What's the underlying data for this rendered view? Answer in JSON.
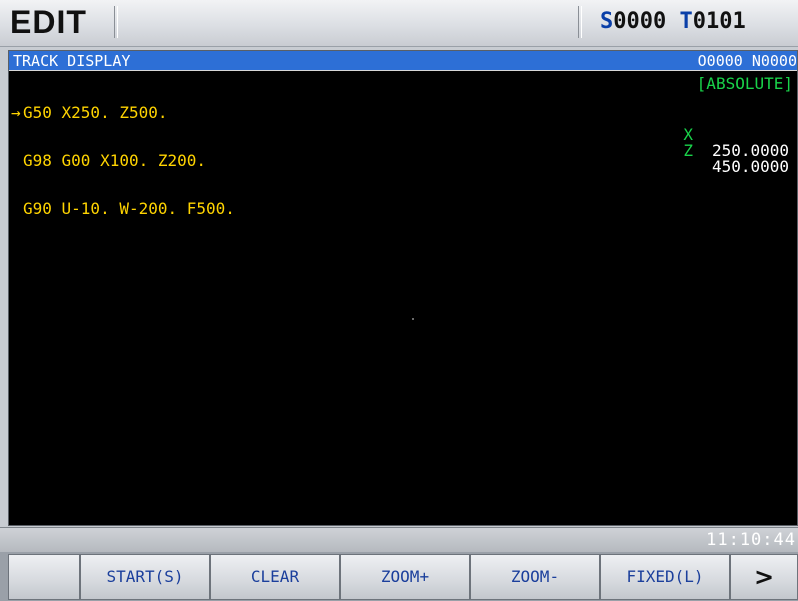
{
  "header": {
    "mode": "EDIT",
    "spindle_prefix": "S",
    "spindle_value": "0000",
    "tool_prefix": "T",
    "tool_value": "0101"
  },
  "screen": {
    "title": "TRACK DISPLAY",
    "program_number": "O0000 N0000",
    "code_lines": [
      "G50 X250. Z500.",
      "G98 G00 X100. Z200.",
      "G90 U-10. W-200. F500."
    ],
    "current_line_marker": "→",
    "coord_mode": "[ABSOLUTE]",
    "coords": [
      {
        "axis": "X",
        "value": "250.0000"
      },
      {
        "axis": "Z",
        "value": "450.0000"
      }
    ]
  },
  "status": {
    "time": "11:10:44"
  },
  "softkeys": [
    {
      "label": ""
    },
    {
      "label": "START(S)"
    },
    {
      "label": "CLEAR"
    },
    {
      "label": "ZOOM+"
    },
    {
      "label": "ZOOM-"
    },
    {
      "label": "FIXED(L)"
    },
    {
      "label": ">"
    }
  ],
  "colors": {
    "title_bar": "#2d6fd6",
    "code_text": "#ffd400",
    "coord_label": "#19d34a",
    "softkey_text": "#1b3f9c",
    "spindle_tool_accent": "#0a3fa8"
  }
}
